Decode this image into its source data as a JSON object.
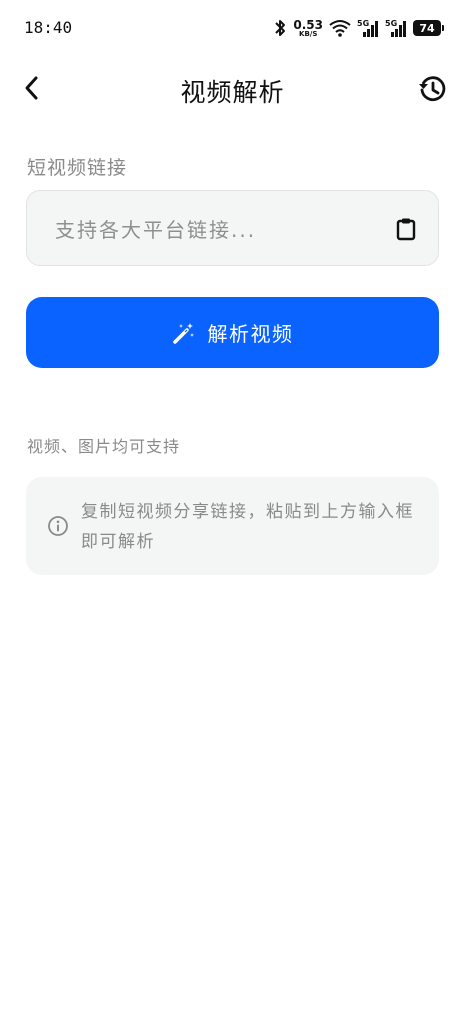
{
  "status_bar": {
    "time": "18:40",
    "speed_value": "0.53",
    "speed_unit": "KB/S",
    "signal_1_label": "5G",
    "signal_2_label": "5G",
    "battery_level": "74",
    "icons": [
      "bluetooth-icon",
      "wifi-icon",
      "signal-icon",
      "signal-icon",
      "battery-icon"
    ]
  },
  "nav": {
    "title": "视频解析",
    "back_icon": "chevron-left-icon",
    "history_icon": "history-icon"
  },
  "form": {
    "section_label": "短视频链接",
    "link_value": "",
    "link_placeholder": "支持各大平台链接...",
    "paste_icon": "clipboard-icon",
    "parse_button_label": "解析视频",
    "parse_button_icon": "magic-wand-icon",
    "accent_color": "#0a63ff"
  },
  "support_note": "视频、图片均可支持",
  "tip": {
    "icon": "info-icon",
    "text": "复制短视频分享链接，粘贴到上方输入框即可解析"
  }
}
